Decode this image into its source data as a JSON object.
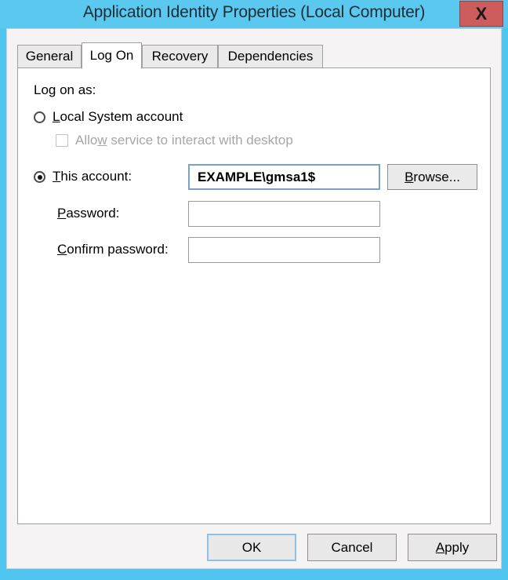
{
  "window": {
    "title": "Application Identity Properties (Local Computer)",
    "close_label": "X",
    "frame_color": "#5ac8ef",
    "close_color": "#cd5c5c"
  },
  "tabs": [
    {
      "label": "General",
      "active": false
    },
    {
      "label": "Log On",
      "active": true
    },
    {
      "label": "Recovery",
      "active": false
    },
    {
      "label": "Dependencies",
      "active": false
    }
  ],
  "logon": {
    "section_label": "Log on as:",
    "local_system": {
      "label": "Local System account",
      "accesskey": "L",
      "selected": false
    },
    "allow_interact": {
      "label": "Allow service to interact with desktop",
      "accesskey": "w",
      "checked": false,
      "disabled": true
    },
    "this_account": {
      "label": "This account:",
      "accesskey": "T",
      "selected": true,
      "value": "EXAMPLE\\gmsa1$",
      "placeholder": ""
    },
    "browse_label": "Browse...",
    "password": {
      "label": "Password:",
      "accesskey": "P",
      "value": "",
      "placeholder": ""
    },
    "confirm_password": {
      "label": "Confirm password:",
      "accesskey": "C",
      "value": "",
      "placeholder": ""
    }
  },
  "footer": {
    "ok_label": "OK",
    "cancel_label": "Cancel",
    "apply_label": "Apply"
  }
}
